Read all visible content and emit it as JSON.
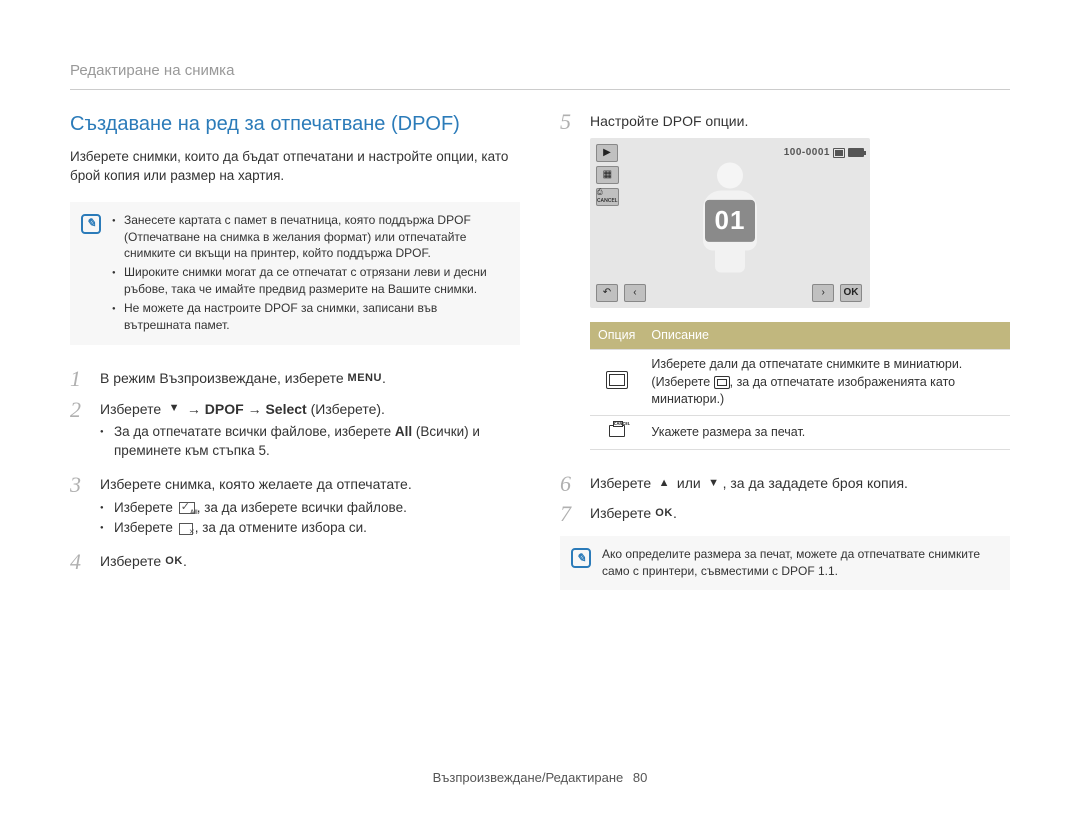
{
  "breadcrumb": "Редактиране на снимка",
  "section_title": "Създаване на ред за отпечатване (DPOF)",
  "intro": "Изберете снимки, които да бъдат отпечатани и настройте опции, като брой копия или размер на хартия.",
  "notes_top": [
    "Занесете картата с памет в печатница, която поддържа DPOF (Отпечатване на снимка в желания формат) или отпечатайте снимките си вкъщи на принтер, който поддържа DPOF.",
    "Широките снимки могат да се отпечатат с отрязани леви и десни ръбове, така че имайте предвид размерите на Вашите снимки.",
    "Не можете да настроите DPOF за снимки, записани във вътрешната памет."
  ],
  "steps": {
    "s1": {
      "num": "1",
      "pre": "В режим Възпроизвеждане, изберете ",
      "icon": "MENU",
      "post": "."
    },
    "s2": {
      "num": "2",
      "pre": "Изберете ",
      "arrow": "▼",
      "seg1": " → ",
      "b1": "DPOF",
      "seg2": " → ",
      "b2": "Select",
      "seg3": " (Изберете).",
      "bullet": {
        "pre": "За да отпечатате всички файлове, изберете ",
        "b": "All",
        "post": " (Всички) и преминете към стъпка 5."
      }
    },
    "s3": {
      "num": "3",
      "text": "Изберете снимка, която желаете да отпечатате.",
      "b1_pre": "Изберете ",
      "b1_post": ", за да изберете всички файлове.",
      "b2_pre": "Изберете ",
      "b2_post": ", за да отмените избора си."
    },
    "s4": {
      "num": "4",
      "pre": "Изберете ",
      "icon": "OK",
      "post": "."
    },
    "s5": {
      "num": "5",
      "text": "Настройте DPOF опции."
    },
    "s6": {
      "num": "6",
      "pre": "Изберете ",
      "up": "▲",
      "mid": " или ",
      "down": "▼",
      "post": ", за да зададете броя копия."
    },
    "s7": {
      "num": "7",
      "pre": "Изберете ",
      "icon": "OK",
      "post": "."
    }
  },
  "screen": {
    "file_index": "100-0001",
    "count": "01",
    "back": "↶",
    "left": "‹",
    "right": "›",
    "ok": "OK",
    "play": "▶",
    "thumb": "▦",
    "print": "⎙"
  },
  "options_table": {
    "h1": "Опция",
    "h2": "Описание",
    "r1_pre": "Изберете дали да отпечатате снимките в миниатюри. (Изберете ",
    "r1_post": ", за да отпечатате изображенията като миниатюри.)",
    "r2": "Укажете размера за печат."
  },
  "note_bottom": "Ако определите размера за печат, можете да отпечатвате снимките само с принтери, съвместими с DPOF 1.1.",
  "footer_label": "Възпроизвеждане/Редактиране",
  "footer_page": "80"
}
